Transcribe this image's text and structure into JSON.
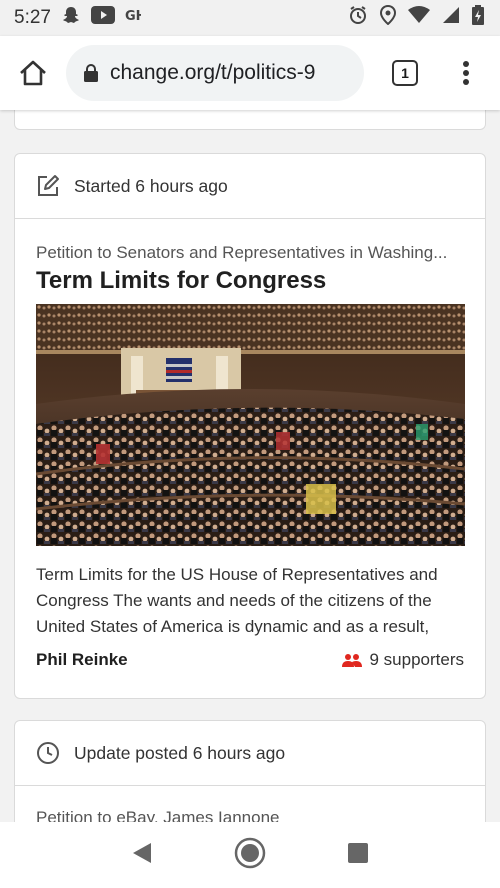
{
  "status_bar": {
    "time": "5:27",
    "left_icons": [
      "snapchat-icon",
      "youtube-icon",
      "app-icon"
    ],
    "right_icons": [
      "alarm-icon",
      "location-icon",
      "wifi-icon",
      "signal-icon",
      "battery-icon"
    ]
  },
  "browser": {
    "url": "change.org/t/politics-9",
    "tab_count": "1"
  },
  "feed": {
    "cards": [
      {
        "header": "Started 6 hours ago",
        "target": "Petition to Senators and Representatives in Washing...",
        "title": "Term Limits for Congress",
        "description": "Term Limits for the US House of Representatives and Congress   The wants and needs of the citizens of the United States of America is dynamic and as a result,",
        "author": "Phil Reinke",
        "supporters": "9 supporters"
      },
      {
        "header": "Update posted 6 hours ago",
        "target": "Petition to eBay, James Iannone"
      }
    ]
  },
  "colors": {
    "accent": "#e0271f",
    "card_border": "#dadada"
  }
}
